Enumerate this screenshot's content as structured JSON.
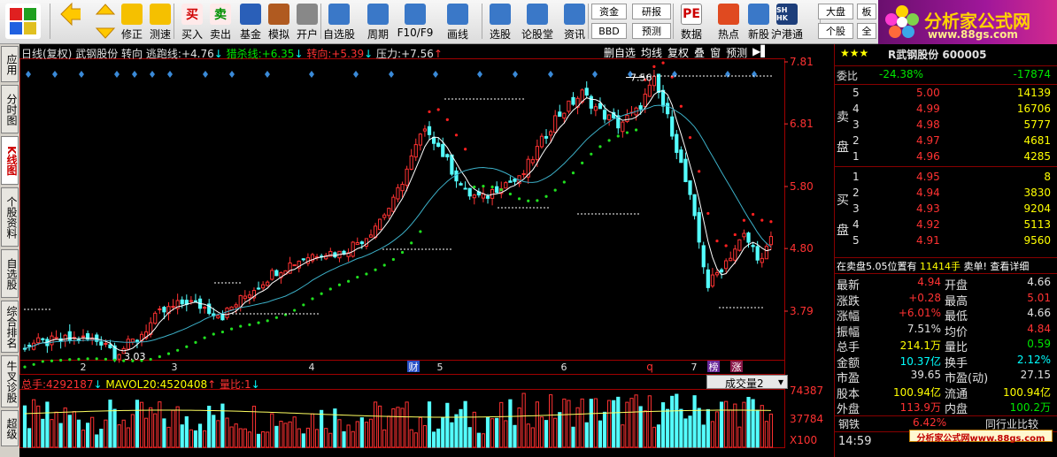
{
  "toolbar": {
    "buttons": [
      {
        "label": "",
        "icon": "grid-icon"
      },
      {
        "label": "",
        "icon": "back-arrow-icon"
      },
      {
        "label": "",
        "icon": "up-down-arrows-icon"
      },
      {
        "label": "修正",
        "icon": "refresh-icon"
      },
      {
        "label": "测速",
        "icon": "clock-icon"
      },
      {
        "label": "买入",
        "icon": "buy-icon",
        "glyph": "买"
      },
      {
        "label": "卖出",
        "icon": "sell-icon",
        "glyph": "卖"
      },
      {
        "label": "基金",
        "icon": "fund-icon"
      },
      {
        "label": "模拟",
        "icon": "hammer-icon"
      },
      {
        "label": "开户",
        "icon": "lock-icon"
      },
      {
        "label": "自选股",
        "icon": "star-icon"
      },
      {
        "label": "周期",
        "icon": "period-icon"
      },
      {
        "label": "F10/F9",
        "icon": "f10-icon"
      },
      {
        "label": "画线",
        "icon": "pen-icon"
      },
      {
        "label": "选股",
        "icon": "select-icon"
      },
      {
        "label": "论股堂",
        "icon": "forum-icon"
      },
      {
        "label": "资讯",
        "icon": "info-icon"
      },
      {
        "label": "数据",
        "icon": "pe-icon",
        "glyph": "PE"
      },
      {
        "label": "热点",
        "icon": "fire-icon"
      },
      {
        "label": "新股",
        "icon": "new-stock-icon"
      },
      {
        "label": "沪港通",
        "icon": "shhk-icon",
        "glyph": "SH HK"
      }
    ],
    "drops": {
      "zijin": "资金",
      "bbd": "BBD",
      "yanbao": "研报",
      "yuce": "预测",
      "dapan": "大盘",
      "gegu": "个股",
      "ban": "板",
      "quan": "全"
    }
  },
  "logo": {
    "brand": "分析家公式网",
    "url": "www.88gs.com"
  },
  "left_tabs": [
    "应用",
    "分时图",
    "K线图",
    "个股资料",
    "自选股",
    "综合排名",
    "牛叉诊股",
    "超级"
  ],
  "chart_header": {
    "period": "日线(复权)",
    "stock": "武钢股份",
    "trend": "转向",
    "escape_label": "逃跑线:",
    "escape_val": "+4.76",
    "hunt_label": "猎杀线:",
    "hunt_val": "+6.35",
    "turn_label": "转向:",
    "turn_val": "+5.39",
    "press_label": "压力:",
    "press_val": "+7.56"
  },
  "chart_tools": [
    "删自选",
    "均线",
    "复权",
    "叠",
    "窗",
    "预测"
  ],
  "price_axis": [
    "7.81",
    "6.81",
    "5.80",
    "4.80",
    "3.79"
  ],
  "annotations": {
    "high": "7.56",
    "low": "3.03",
    "cai": "财",
    "bang": "榜",
    "zhang": "涨",
    "q": "q"
  },
  "month_labels": [
    "2",
    "3",
    "4",
    "5",
    "6",
    "7"
  ],
  "volume_header": {
    "total_label": "总手:",
    "total_val": "4292187",
    "ma_label": "MAVOL20:",
    "ma_val": "4520408",
    "ratio_label": "量比:",
    "ratio_val": "1",
    "dropdown": "成交量2"
  },
  "volume_axis": [
    "74387",
    "37784",
    "X100"
  ],
  "right_panel": {
    "stars": "★★★",
    "title": "R武钢股份 600005",
    "weibi_label": "委比",
    "weibi_pct": "-24.38%",
    "weibi_val": "-17874",
    "sell_label": "卖盘",
    "buy_label": "买盘",
    "asks": [
      {
        "n": "5",
        "p": "5.00",
        "v": "14139"
      },
      {
        "n": "4",
        "p": "4.99",
        "v": "16706"
      },
      {
        "n": "3",
        "p": "4.98",
        "v": "5777"
      },
      {
        "n": "2",
        "p": "4.97",
        "v": "4681"
      },
      {
        "n": "1",
        "p": "4.96",
        "v": "4285"
      }
    ],
    "bids": [
      {
        "n": "1",
        "p": "4.95",
        "v": "8"
      },
      {
        "n": "2",
        "p": "4.94",
        "v": "3830"
      },
      {
        "n": "3",
        "p": "4.93",
        "v": "9204"
      },
      {
        "n": "4",
        "p": "4.92",
        "v": "5113"
      },
      {
        "n": "5",
        "p": "4.91",
        "v": "9560"
      }
    ],
    "status_left": "在卖盘5.05位置有",
    "status_vol": "11414手",
    "status_right": "卖单! 查看详细",
    "quote": [
      {
        "l": "最新",
        "v": "4.94",
        "vc": "red",
        "l2": "开盘",
        "v2": "4.66",
        "v2c": "white"
      },
      {
        "l": "涨跌",
        "v": "+0.28",
        "vc": "red",
        "l2": "最高",
        "v2": "5.01",
        "v2c": "red"
      },
      {
        "l": "涨幅",
        "v": "+6.01%",
        "vc": "red",
        "l2": "最低",
        "v2": "4.66",
        "v2c": "white"
      },
      {
        "l": "振幅",
        "v": "7.51%",
        "vc": "white",
        "l2": "均价",
        "v2": "4.84",
        "v2c": "red"
      },
      {
        "l": "总手",
        "v": "214.1万",
        "vc": "yellow",
        "l2": "量比",
        "v2": "0.59",
        "v2c": "green"
      },
      {
        "l": "金额",
        "v": "10.37亿",
        "vc": "cyan",
        "l2": "换手",
        "v2": "2.12%",
        "v2c": "cyan"
      },
      {
        "l": "市盈",
        "v": "39.65",
        "vc": "white",
        "l2": "市盈(动)",
        "v2": "27.15",
        "v2c": "white"
      },
      {
        "l": "股本",
        "v": "100.94亿",
        "vc": "yellow",
        "l2": "流通",
        "v2": "100.94亿",
        "v2c": "yellow"
      },
      {
        "l": "外盘",
        "v": "113.9万",
        "vc": "red",
        "l2": "内盘",
        "v2": "100.2万",
        "v2c": "green"
      }
    ],
    "sector_name": "钢铁",
    "sector_pct": "6.42%",
    "sector_link": "同行业比较",
    "time": "14:59",
    "watermark": "分析家公式网www.88gs.com"
  },
  "colors": {
    "up": "#ff3232",
    "down": "#54ffff",
    "ma1": "#ffffff",
    "ma2": "#3cb0c8",
    "grid_border": "#a00000"
  }
}
